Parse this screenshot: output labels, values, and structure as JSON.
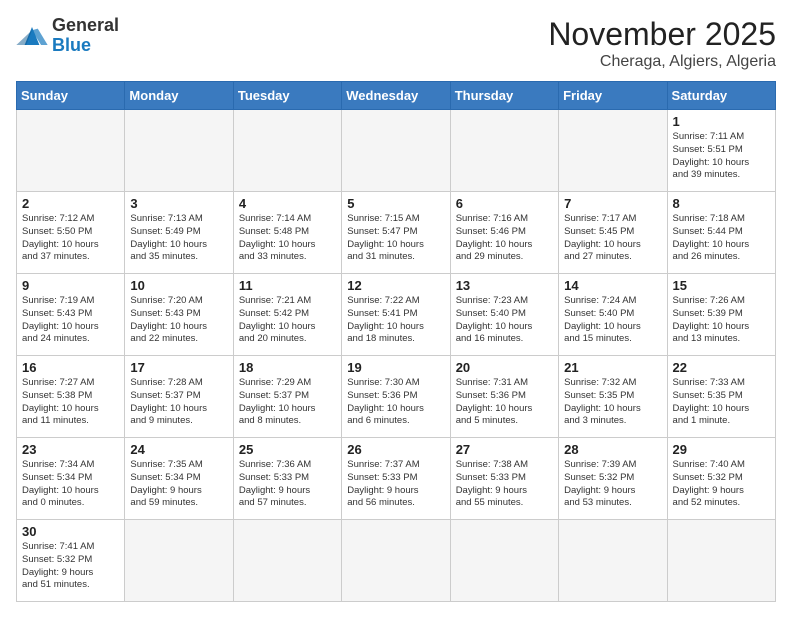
{
  "logo": {
    "text_general": "General",
    "text_blue": "Blue"
  },
  "header": {
    "month": "November 2025",
    "location": "Cheraga, Algiers, Algeria"
  },
  "weekdays": [
    "Sunday",
    "Monday",
    "Tuesday",
    "Wednesday",
    "Thursday",
    "Friday",
    "Saturday"
  ],
  "days": {
    "d1": {
      "n": "1",
      "rise": "7:11 AM",
      "set": "5:51 PM",
      "hrs": "10 hours",
      "min": "39 minutes"
    },
    "d2": {
      "n": "2",
      "rise": "7:12 AM",
      "set": "5:50 PM",
      "hrs": "10 hours",
      "min": "37 minutes"
    },
    "d3": {
      "n": "3",
      "rise": "7:13 AM",
      "set": "5:49 PM",
      "hrs": "10 hours",
      "min": "35 minutes"
    },
    "d4": {
      "n": "4",
      "rise": "7:14 AM",
      "set": "5:48 PM",
      "hrs": "10 hours",
      "min": "33 minutes"
    },
    "d5": {
      "n": "5",
      "rise": "7:15 AM",
      "set": "5:47 PM",
      "hrs": "10 hours",
      "min": "31 minutes"
    },
    "d6": {
      "n": "6",
      "rise": "7:16 AM",
      "set": "5:46 PM",
      "hrs": "10 hours",
      "min": "29 minutes"
    },
    "d7": {
      "n": "7",
      "rise": "7:17 AM",
      "set": "5:45 PM",
      "hrs": "10 hours",
      "min": "27 minutes"
    },
    "d8": {
      "n": "8",
      "rise": "7:18 AM",
      "set": "5:44 PM",
      "hrs": "10 hours",
      "min": "26 minutes"
    },
    "d9": {
      "n": "9",
      "rise": "7:19 AM",
      "set": "5:43 PM",
      "hrs": "10 hours",
      "min": "24 minutes"
    },
    "d10": {
      "n": "10",
      "rise": "7:20 AM",
      "set": "5:43 PM",
      "hrs": "10 hours",
      "min": "22 minutes"
    },
    "d11": {
      "n": "11",
      "rise": "7:21 AM",
      "set": "5:42 PM",
      "hrs": "10 hours",
      "min": "20 minutes"
    },
    "d12": {
      "n": "12",
      "rise": "7:22 AM",
      "set": "5:41 PM",
      "hrs": "10 hours",
      "min": "18 minutes"
    },
    "d13": {
      "n": "13",
      "rise": "7:23 AM",
      "set": "5:40 PM",
      "hrs": "10 hours",
      "min": "16 minutes"
    },
    "d14": {
      "n": "14",
      "rise": "7:24 AM",
      "set": "5:40 PM",
      "hrs": "10 hours",
      "min": "15 minutes"
    },
    "d15": {
      "n": "15",
      "rise": "7:26 AM",
      "set": "5:39 PM",
      "hrs": "10 hours",
      "min": "13 minutes"
    },
    "d16": {
      "n": "16",
      "rise": "7:27 AM",
      "set": "5:38 PM",
      "hrs": "10 hours",
      "min": "11 minutes"
    },
    "d17": {
      "n": "17",
      "rise": "7:28 AM",
      "set": "5:37 PM",
      "hrs": "10 hours",
      "min": "9 minutes"
    },
    "d18": {
      "n": "18",
      "rise": "7:29 AM",
      "set": "5:37 PM",
      "hrs": "10 hours",
      "min": "8 minutes"
    },
    "d19": {
      "n": "19",
      "rise": "7:30 AM",
      "set": "5:36 PM",
      "hrs": "10 hours",
      "min": "6 minutes"
    },
    "d20": {
      "n": "20",
      "rise": "7:31 AM",
      "set": "5:36 PM",
      "hrs": "10 hours",
      "min": "5 minutes"
    },
    "d21": {
      "n": "21",
      "rise": "7:32 AM",
      "set": "5:35 PM",
      "hrs": "10 hours",
      "min": "3 minutes"
    },
    "d22": {
      "n": "22",
      "rise": "7:33 AM",
      "set": "5:35 PM",
      "hrs": "10 hours",
      "min": "1 minute"
    },
    "d23": {
      "n": "23",
      "rise": "7:34 AM",
      "set": "5:34 PM",
      "hrs": "10 hours",
      "min": "0 minutes"
    },
    "d24": {
      "n": "24",
      "rise": "7:35 AM",
      "set": "5:34 PM",
      "hrs": "9 hours",
      "min": "59 minutes"
    },
    "d25": {
      "n": "25",
      "rise": "7:36 AM",
      "set": "5:33 PM",
      "hrs": "9 hours",
      "min": "57 minutes"
    },
    "d26": {
      "n": "26",
      "rise": "7:37 AM",
      "set": "5:33 PM",
      "hrs": "9 hours",
      "min": "56 minutes"
    },
    "d27": {
      "n": "27",
      "rise": "7:38 AM",
      "set": "5:33 PM",
      "hrs": "9 hours",
      "min": "55 minutes"
    },
    "d28": {
      "n": "28",
      "rise": "7:39 AM",
      "set": "5:32 PM",
      "hrs": "9 hours",
      "min": "53 minutes"
    },
    "d29": {
      "n": "29",
      "rise": "7:40 AM",
      "set": "5:32 PM",
      "hrs": "9 hours",
      "min": "52 minutes"
    },
    "d30": {
      "n": "30",
      "rise": "7:41 AM",
      "set": "5:32 PM",
      "hrs": "9 hours",
      "min": "51 minutes"
    }
  },
  "labels": {
    "sunrise": "Sunrise:",
    "sunset": "Sunset:",
    "daylight": "Daylight:"
  }
}
